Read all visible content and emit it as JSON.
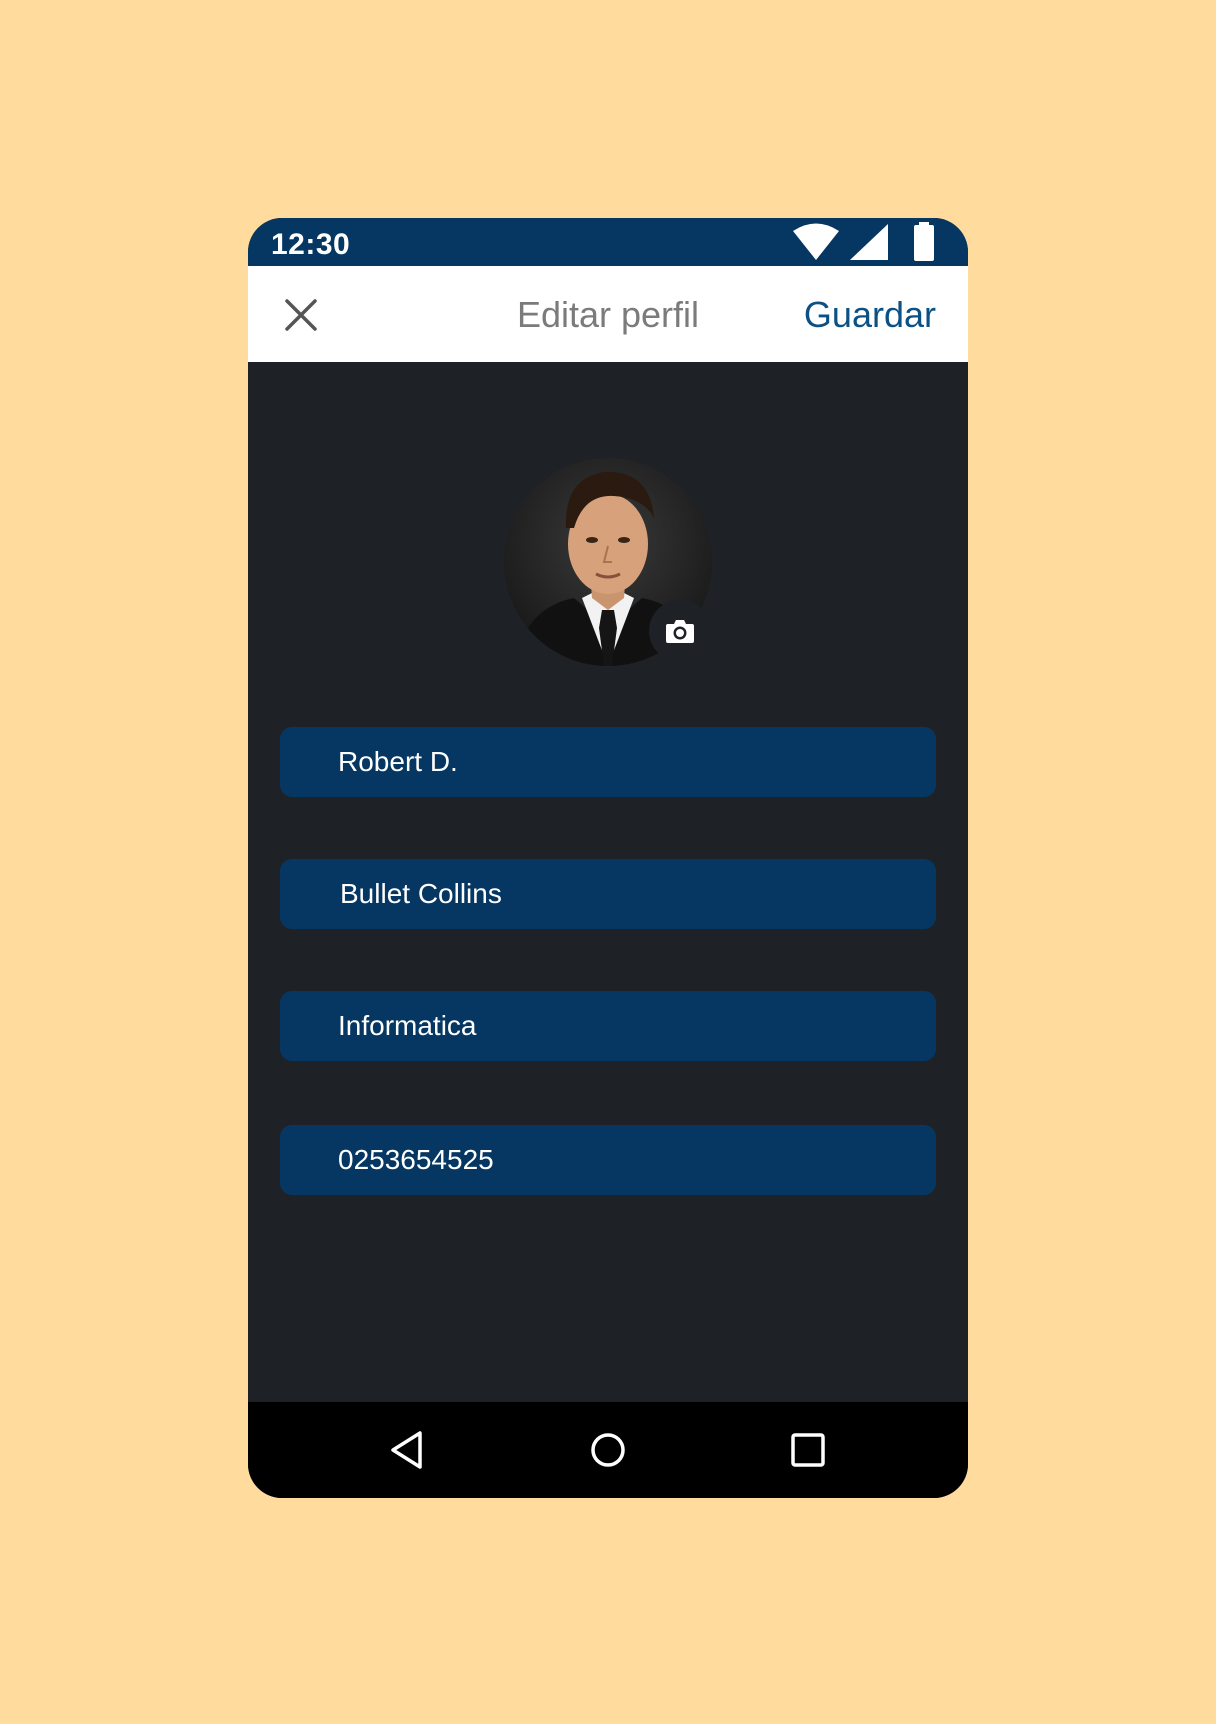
{
  "status_bar": {
    "time": "12:30",
    "icons": [
      "wifi-icon",
      "signal-icon",
      "battery-icon"
    ],
    "background": "#063762"
  },
  "app_bar": {
    "close_icon": "close-icon",
    "title": "Editar perfil",
    "save_label": "Guardar",
    "save_color": "#0B5185"
  },
  "profile": {
    "avatar": "avatar-photo",
    "camera_icon": "camera-icon"
  },
  "fields": [
    {
      "value": "Robert D."
    },
    {
      "value": "Bullet Collins"
    },
    {
      "value": "Informatica"
    },
    {
      "value": "0253654525"
    }
  ],
  "nav_bar": {
    "icons": [
      "back-icon",
      "home-icon",
      "recents-icon"
    ]
  },
  "colors": {
    "page_background": "#FFDB9E",
    "content_background": "#1E2125",
    "field_background": "#063762"
  }
}
